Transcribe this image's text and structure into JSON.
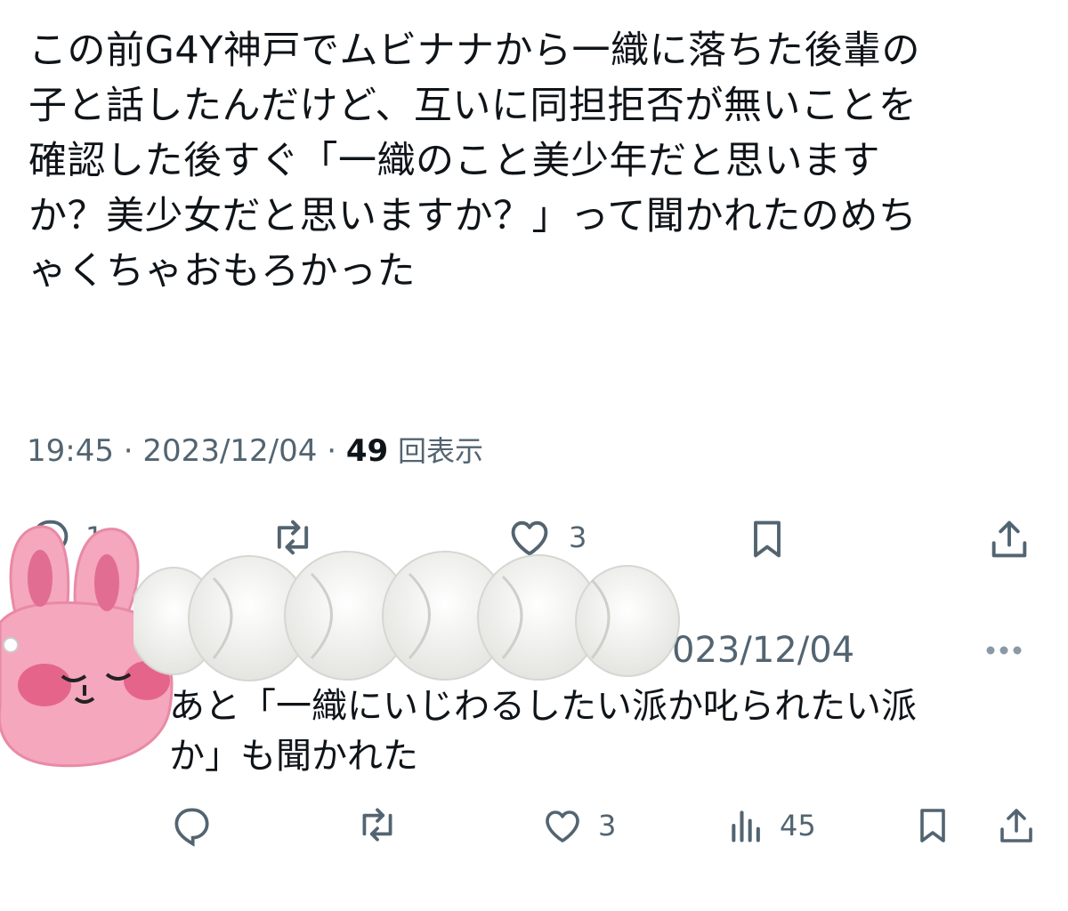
{
  "tweet": {
    "lines": [
      "この前G4Y神戸でムビナナから一織に落ちた後輩の",
      "子と話したんだけど、互いに同担拒否が無いことを",
      "確認した後すぐ「一織のこと美少年だと思います",
      "か？美少女だと思いますか？」って聞かれたのめち",
      "ゃくちゃおもろかった"
    ],
    "time": "19:45",
    "sep1": " · ",
    "date": "2023/12/04",
    "sep2": " · ",
    "views_count": "49",
    "views_label": "回表示"
  },
  "tweet_actions": {
    "reply_count": "1",
    "retweet_count": "",
    "like_count": "3",
    "icons": [
      "reply-icon",
      "retweet-icon",
      "like-icon",
      "bookmark-icon",
      "share-icon"
    ]
  },
  "reply": {
    "date_visible": "023/12/04",
    "lines": [
      "あと「一織にいじわるしたい派か叱られたい派",
      "か」も聞かれた"
    ],
    "actions": {
      "reply_count": "",
      "retweet_count": "",
      "like_count": "3",
      "views_count": "45"
    }
  },
  "colors": {
    "text": "#0f1419",
    "secondary": "#536471",
    "sticker_pink": "#f2a0b8",
    "cream": "#f7f7f5"
  }
}
